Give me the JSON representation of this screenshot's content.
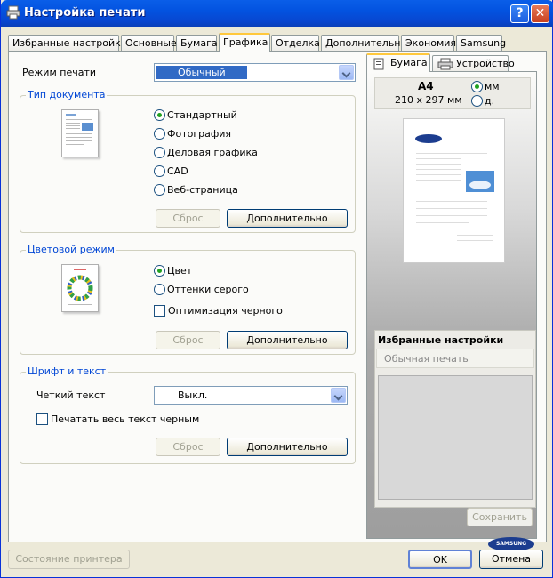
{
  "window": {
    "title": "Настройка печати",
    "help": "?",
    "close": "✕"
  },
  "tabs": [
    "Избранные настройки",
    "Основные",
    "Бумага",
    "Графика",
    "Отделка",
    "Дополнительно",
    "Экономия",
    "Samsung"
  ],
  "print_mode": {
    "label": "Режим печати",
    "value": "Обычный"
  },
  "doc_type": {
    "title": "Тип документа",
    "options": [
      "Стандартный",
      "Фотография",
      "Деловая графика",
      "CAD",
      "Веб-страница"
    ],
    "selected": 0,
    "reset": "Сброс",
    "advanced": "Дополнительно"
  },
  "color_mode": {
    "title": "Цветовой режим",
    "options": [
      "Цвет",
      "Оттенки серого"
    ],
    "selected": 0,
    "black_opt": "Оптимизация черного",
    "reset": "Сброс",
    "advanced": "Дополнительно"
  },
  "font_text": {
    "title": "Шрифт и текст",
    "clear_label": "Четкий текст",
    "clear_value": "Выкл.",
    "all_black": "Печатать весь текст черным",
    "reset": "Сброс",
    "advanced": "Дополнительно"
  },
  "preview": {
    "tab_paper": "Бумага",
    "tab_device": "Устройство",
    "paper_name": "A4",
    "paper_size": "210 x 297 мм",
    "unit_mm": "мм",
    "unit_in": "д.",
    "brand": "SAMSUNG"
  },
  "favorites": {
    "title": "Избранные настройки",
    "value": "Обычная печать",
    "save": "Сохранить"
  },
  "footer": {
    "printer_status": "Состояние принтера",
    "ok": "OK",
    "cancel": "Отмена"
  }
}
